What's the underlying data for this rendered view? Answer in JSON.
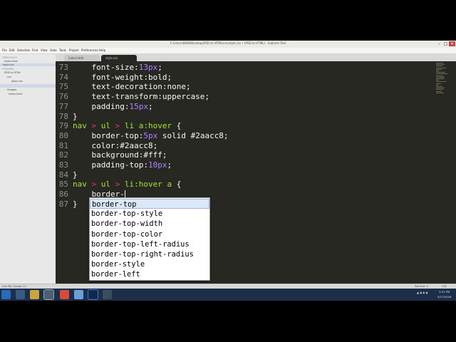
{
  "window": {
    "title": "C:\\Users\\8808\\Desktop\\PSD to HTML\\css\\style.css • (PSD to HTML) - Sublime Text"
  },
  "menu": [
    "File",
    "Edit",
    "Selection",
    "Find",
    "View",
    "Goto",
    "Tools",
    "Project",
    "Preferences",
    "Help"
  ],
  "sidebar": {
    "open_files_header": "OPEN FILES",
    "open_files": [
      "index.html",
      "style.css"
    ],
    "folders_header": "FOLDERS",
    "tree": [
      "PSD to HTML",
      "css",
      "style.css",
      "images",
      "index.html"
    ]
  },
  "tabs": [
    {
      "label": "index.html",
      "active": false
    },
    {
      "label": "style.css",
      "active": true
    }
  ],
  "code_lines": [
    {
      "num": "73",
      "parts": [
        {
          "t": "    font-size:",
          "c": "prop"
        },
        {
          "t": "13px",
          "c": "val"
        },
        {
          "t": ";",
          "c": "prop"
        }
      ]
    },
    {
      "num": "74",
      "parts": [
        {
          "t": "    font-weight:bold;",
          "c": "prop"
        }
      ]
    },
    {
      "num": "75",
      "parts": [
        {
          "t": "    text-decoration:none;",
          "c": "prop"
        }
      ]
    },
    {
      "num": "76",
      "parts": [
        {
          "t": "    text-transform:uppercase;",
          "c": "prop"
        }
      ]
    },
    {
      "num": "77",
      "parts": [
        {
          "t": "    padding:",
          "c": "prop"
        },
        {
          "t": "15px",
          "c": "val"
        },
        {
          "t": ";",
          "c": "prop"
        }
      ]
    },
    {
      "num": "78",
      "parts": [
        {
          "t": "}",
          "c": "brace"
        }
      ]
    },
    {
      "num": "79",
      "parts": [
        {
          "t": "nav ",
          "c": "sel"
        },
        {
          "t": "> ",
          "c": "op"
        },
        {
          "t": "ul ",
          "c": "sel"
        },
        {
          "t": "> ",
          "c": "op"
        },
        {
          "t": "li a:hover ",
          "c": "sel"
        },
        {
          "t": "{",
          "c": "brace"
        }
      ]
    },
    {
      "num": "80",
      "parts": [
        {
          "t": "    border-top:",
          "c": "prop"
        },
        {
          "t": "5px",
          "c": "val"
        },
        {
          "t": " solid #2aacc8;",
          "c": "prop"
        }
      ]
    },
    {
      "num": "81",
      "parts": [
        {
          "t": "    color:#2aacc8;",
          "c": "prop"
        }
      ]
    },
    {
      "num": "82",
      "parts": [
        {
          "t": "    background:#fff;",
          "c": "prop"
        }
      ]
    },
    {
      "num": "83",
      "parts": [
        {
          "t": "    padding-top:",
          "c": "prop"
        },
        {
          "t": "10px",
          "c": "val"
        },
        {
          "t": ";",
          "c": "prop"
        }
      ]
    },
    {
      "num": "84",
      "parts": [
        {
          "t": "}",
          "c": "brace"
        }
      ]
    },
    {
      "num": "85",
      "parts": [
        {
          "t": "nav ",
          "c": "sel"
        },
        {
          "t": "> ",
          "c": "op"
        },
        {
          "t": "ul ",
          "c": "sel"
        },
        {
          "t": "> ",
          "c": "op"
        },
        {
          "t": "li:hover a ",
          "c": "sel"
        },
        {
          "t": "{",
          "c": "brace"
        }
      ]
    },
    {
      "num": "86",
      "parts": [
        {
          "t": "    border-",
          "c": "prop"
        }
      ]
    },
    {
      "num": "87",
      "parts": [
        {
          "t": "}",
          "c": "brace"
        }
      ]
    }
  ],
  "autocomplete": {
    "selected_index": 0,
    "items": [
      "border-top",
      "border-top-style",
      "border-top-width",
      "border-top-color",
      "border-top-left-radius",
      "border-top-right-radius",
      "border-style",
      "border-left"
    ]
  },
  "status": {
    "left": "Line 86, Column 11",
    "tab_size": "Tab Size: 4",
    "syntax": "CSS"
  },
  "taskbar": {
    "time": "3:51 PM",
    "date": "5/17/2016"
  },
  "colors": {
    "editor_bg": "#272822",
    "selector": "#a6e22e",
    "number": "#ae81ff",
    "operator": "#f92672",
    "text": "#f8f8f2"
  }
}
